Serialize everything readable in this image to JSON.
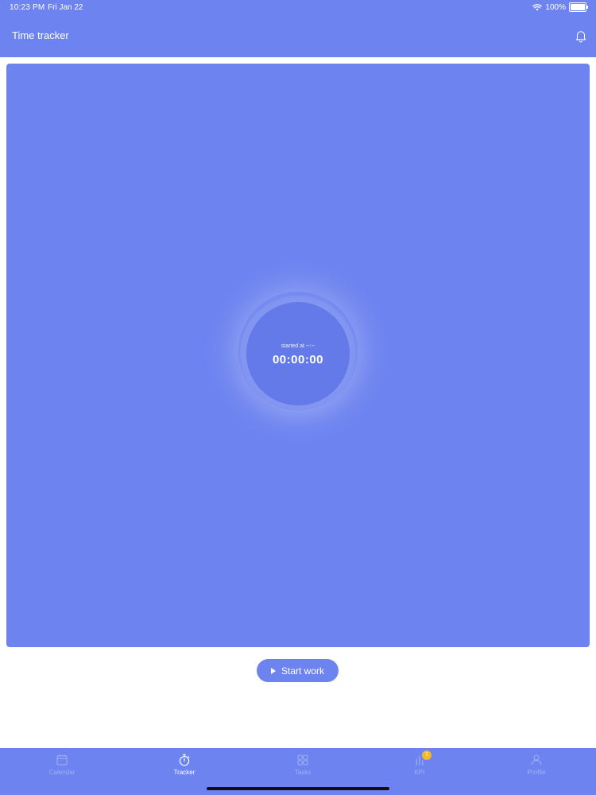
{
  "status_bar": {
    "time": "10:23 PM",
    "date": "Fri Jan 22",
    "battery": "100%"
  },
  "header": {
    "title": "Time tracker",
    "notification_icon": "bell-icon"
  },
  "timer": {
    "started_label": "started at --:--",
    "value": "00:00:00"
  },
  "actions": {
    "start_label": "Start work"
  },
  "tabs": [
    {
      "label": "Calendar",
      "icon": "calendar-icon",
      "active": false
    },
    {
      "label": "Tracker",
      "icon": "stopwatch-icon",
      "active": true
    },
    {
      "label": "Tasks",
      "icon": "grid-icon",
      "active": false
    },
    {
      "label": "KPI",
      "icon": "bars-icon",
      "active": false,
      "badge": "1"
    },
    {
      "label": "Profile",
      "icon": "user-icon",
      "active": false
    }
  ],
  "colors": {
    "primary": "#6d84f0",
    "badge": "#f5b62a",
    "background": "#ffffff"
  }
}
